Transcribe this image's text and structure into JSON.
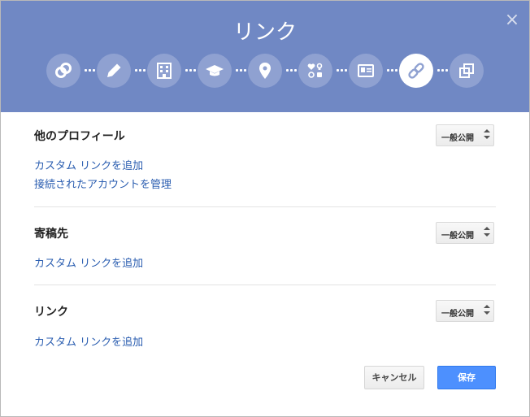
{
  "dialog": {
    "title": "リンク",
    "close_label": "×",
    "steps": [
      {
        "icon": "circles-icon"
      },
      {
        "icon": "pencil-icon"
      },
      {
        "icon": "building-icon"
      },
      {
        "icon": "graduation-cap-icon"
      },
      {
        "icon": "map-pin-icon"
      },
      {
        "icon": "symbols-icon"
      },
      {
        "icon": "contact-card-icon"
      },
      {
        "icon": "link-icon",
        "active": true
      },
      {
        "icon": "copy-icon"
      }
    ],
    "colors": {
      "header": "#7088c4",
      "step_bg": "#8fa1d1",
      "link": "#2a5db0",
      "save_button": "#4d90fe"
    }
  },
  "sections": {
    "other_profiles": {
      "title": "他のプロフィール",
      "visibility": "一般公開",
      "links": [
        "カスタム リンクを追加",
        "接続されたアカウントを管理"
      ]
    },
    "contributor_to": {
      "title": "寄稿先",
      "visibility": "一般公開",
      "links": [
        "カスタム リンクを追加"
      ]
    },
    "links": {
      "title": "リンク",
      "visibility": "一般公開",
      "links": [
        "カスタム リンクを追加"
      ]
    }
  },
  "footer": {
    "cancel_label": "キャンセル",
    "save_label": "保存"
  }
}
